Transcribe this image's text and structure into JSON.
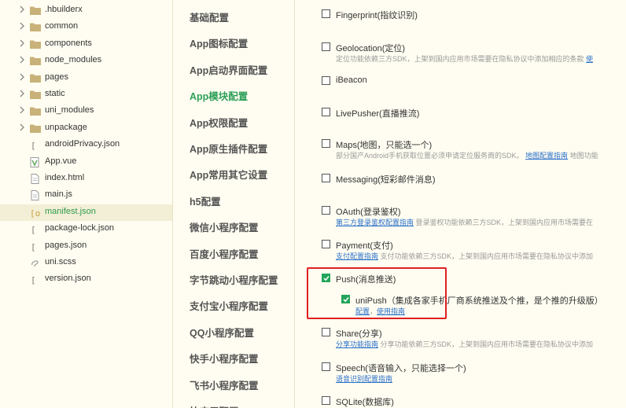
{
  "file_tree": [
    {
      "name": ".hbuilderx",
      "type": "folder"
    },
    {
      "name": "common",
      "type": "folder"
    },
    {
      "name": "components",
      "type": "folder"
    },
    {
      "name": "node_modules",
      "type": "folder"
    },
    {
      "name": "pages",
      "type": "folder"
    },
    {
      "name": "static",
      "type": "folder"
    },
    {
      "name": "uni_modules",
      "type": "folder"
    },
    {
      "name": "unpackage",
      "type": "folder"
    },
    {
      "name": "androidPrivacy.json",
      "type": "json"
    },
    {
      "name": "App.vue",
      "type": "vue"
    },
    {
      "name": "index.html",
      "type": "file"
    },
    {
      "name": "main.js",
      "type": "file"
    },
    {
      "name": "manifest.json",
      "type": "json",
      "active": true
    },
    {
      "name": "package-lock.json",
      "type": "json"
    },
    {
      "name": "pages.json",
      "type": "json"
    },
    {
      "name": "uni.scss",
      "type": "scss"
    },
    {
      "name": "version.json",
      "type": "json"
    }
  ],
  "nav": [
    {
      "label": "基础配置"
    },
    {
      "label": "App图标配置"
    },
    {
      "label": "App启动界面配置"
    },
    {
      "label": "App模块配置",
      "active": true
    },
    {
      "label": "App权限配置"
    },
    {
      "label": "App原生插件配置"
    },
    {
      "label": "App常用其它设置"
    },
    {
      "label": "h5配置"
    },
    {
      "label": "微信小程序配置"
    },
    {
      "label": "百度小程序配置"
    },
    {
      "label": "字节跳动小程序配置"
    },
    {
      "label": "支付宝小程序配置"
    },
    {
      "label": "QQ小程序配置"
    },
    {
      "label": "快手小程序配置"
    },
    {
      "label": "飞书小程序配置"
    },
    {
      "label": "快应用配置"
    }
  ],
  "modules": [
    {
      "label": "Fingerprint(指纹识别)",
      "checked": false
    },
    {
      "label": "Geolocation(定位)",
      "checked": false,
      "desc_link": "",
      "desc_text": "定位功能依赖三方SDK，上架到国内应用市场需要在隐私协议中添加相应的条款",
      "desc_tail": "使"
    },
    {
      "label": "iBeacon",
      "checked": false
    },
    {
      "label": "LivePusher(直播推流)",
      "checked": false
    },
    {
      "label": "Maps(地图，只能选一个)",
      "checked": false,
      "desc_link": "",
      "desc_text": "部分国产Android手机获取位置必须申请定位服务商的SDK。",
      "desc_tail": "地图配置指南",
      "desc_after": "地图功能"
    },
    {
      "label": "Messaging(短彩邮件消息)",
      "checked": false
    },
    {
      "label": "OAuth(登录鉴权)",
      "checked": false,
      "desc_link": "第三方登录鉴权配置指南",
      "desc_text": "登录鉴权功能依赖三方SDK，上架到国内应用市场需要在"
    },
    {
      "label": "Payment(支付)",
      "checked": false,
      "desc_link": "支付配置指南",
      "desc_text": "支付功能依赖三方SDK，上架到国内应用市场需要在隐私协议中添加"
    },
    {
      "label": "Push(消息推送)",
      "checked": true
    },
    {
      "label": "Share(分享)",
      "checked": false,
      "desc_link": "分享功能指南",
      "desc_text": "分享功能依赖三方SDK，上架到国内应用市场需要在隐私协议中添加"
    },
    {
      "label": "Speech(语音输入，只能选择一个)",
      "checked": false,
      "desc_link": "语音识别配置指南",
      "desc_text": ""
    },
    {
      "label": "SQLite(数据库)",
      "checked": false
    }
  ],
  "unipush": {
    "label": "uniPush（集成各家手机厂商系统推送及个推，是个推的升级版）",
    "checked": true,
    "link1": "配置",
    "separator": "，",
    "link2": "使用指南"
  }
}
